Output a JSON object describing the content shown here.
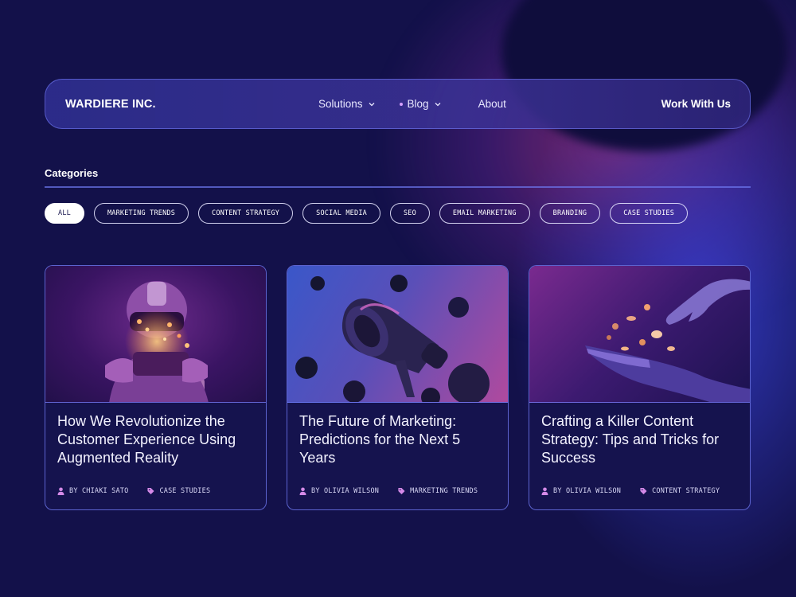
{
  "nav": {
    "brand": "WARDIERE INC.",
    "links": [
      {
        "label": "Solutions"
      },
      {
        "label": "Blog"
      },
      {
        "label": "About"
      }
    ],
    "cta": "Work With Us"
  },
  "categories": {
    "title": "Categories",
    "chips": [
      {
        "label": "ALL",
        "active": true
      },
      {
        "label": "MARKETING TRENDS"
      },
      {
        "label": "CONTENT STRATEGY"
      },
      {
        "label": "SOCIAL MEDIA"
      },
      {
        "label": "SEO"
      },
      {
        "label": "EMAIL MARKETING"
      },
      {
        "label": "BRANDING"
      },
      {
        "label": "CASE STUDIES"
      }
    ]
  },
  "posts": [
    {
      "title": "How We Revolutionize the Customer Experience Using Augmented Reality",
      "author": "BY CHIAKI SATO",
      "category": "CASE STUDIES"
    },
    {
      "title": "The Future of Marketing: Predictions for the Next 5 Years",
      "author": "BY OLIVIA WILSON",
      "category": "MARKETING TRENDS"
    },
    {
      "title": "Crafting a Killer Content Strategy: Tips and Tricks for Success",
      "author": "BY OLIVIA WILSON",
      "category": "CONTENT STRATEGY"
    }
  ],
  "colors": {
    "background": "#13114a",
    "accent_pink": "#d58ae8",
    "border": "#6e78f0"
  }
}
